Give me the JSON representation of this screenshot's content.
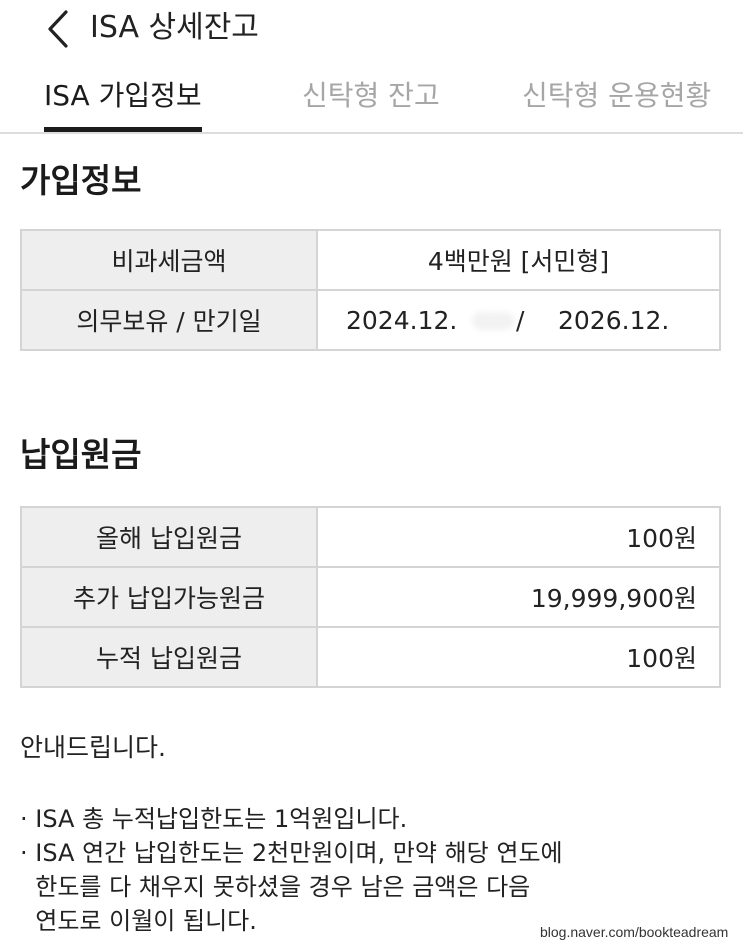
{
  "header": {
    "back_icon": "chevron-left-icon",
    "title": "ISA 상세잔고"
  },
  "tabs": [
    {
      "label": "ISA 가입정보",
      "active": true
    },
    {
      "label": "신탁형 잔고",
      "active": false
    },
    {
      "label": "신탁형 운용현황",
      "active": false
    }
  ],
  "subscription": {
    "title": "가입정보",
    "rows": [
      {
        "label": "비과세금액",
        "value": "4백만원 [서민형]"
      },
      {
        "label": "의무보유 / 만기일",
        "start": "2024.12.",
        "separator": "/",
        "end": "2026.12."
      }
    ]
  },
  "payment": {
    "title": "납입원금",
    "rows": [
      {
        "label": "올해 납입원금",
        "value": "100원"
      },
      {
        "label": "추가 납입가능원금",
        "value": "19,999,900원"
      },
      {
        "label": "누적 납입원금",
        "value": "100원"
      }
    ]
  },
  "notice": {
    "title": "안내드립니다.",
    "lines": [
      "· ISA 총 누적납입한도는 1억원입니다.",
      "· ISA 연간 납입한도는 2천만원이며, 만약 해당 연도에",
      "  한도를 다 채우지 못하셨을 경우 남은 금액은 다음",
      "  연도로 이월이 됩니다."
    ]
  },
  "watermark": "blog.naver.com/bookteadream",
  "colors": {
    "active_tab": "#1b1b1b",
    "inactive_tab": "#a6a6a6",
    "label_bg": "#eeeeee",
    "border": "#d4d4d4"
  }
}
